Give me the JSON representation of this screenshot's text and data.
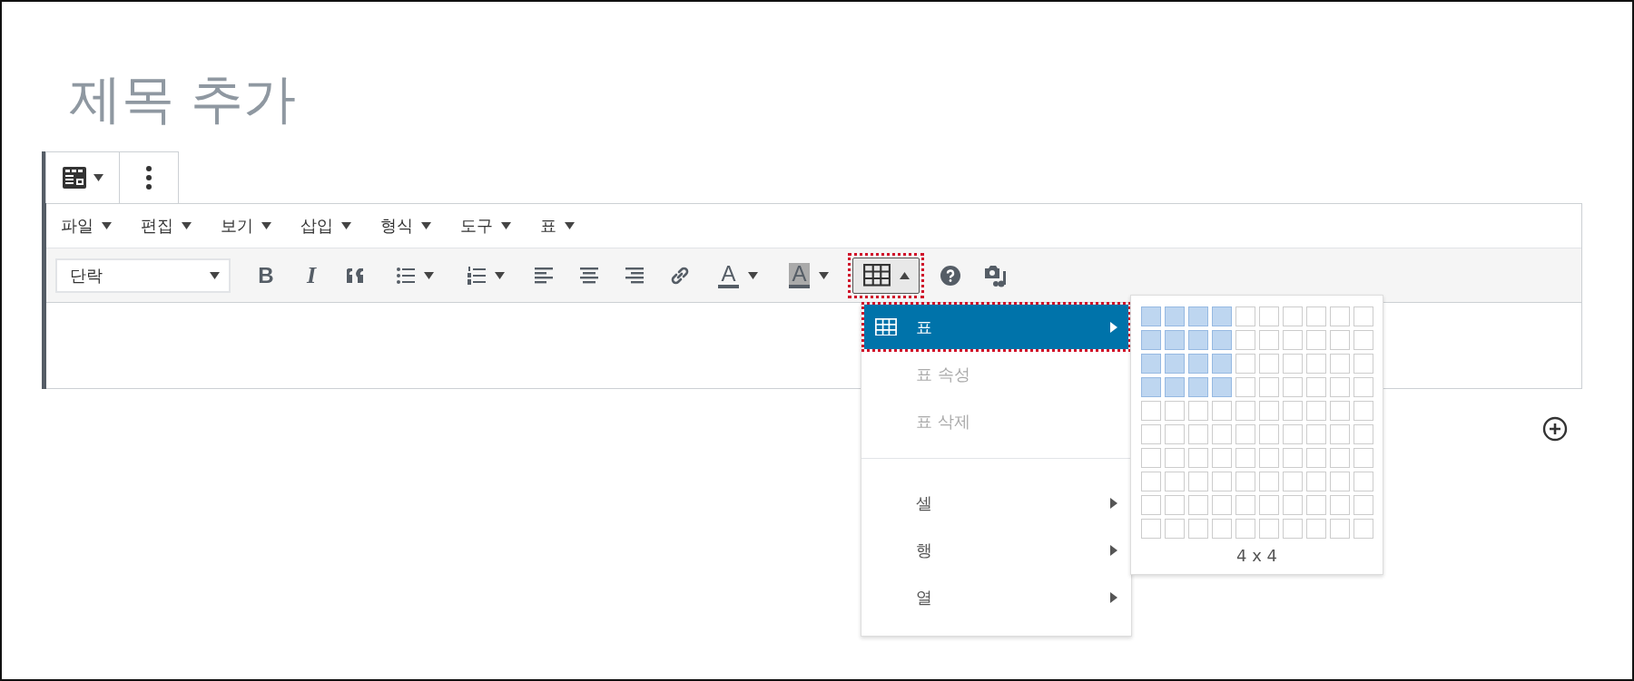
{
  "title_placeholder": "제목 추가",
  "block_toolbar": [
    {
      "kind": "block-type",
      "dropdown": true
    },
    {
      "kind": "more"
    }
  ],
  "menubar": [
    {
      "label": "파일"
    },
    {
      "label": "편집"
    },
    {
      "label": "보기"
    },
    {
      "label": "삽입"
    },
    {
      "label": "형식"
    },
    {
      "label": "도구"
    },
    {
      "label": "표"
    }
  ],
  "toolbar": [
    {
      "kind": "format-select",
      "value": "단락"
    },
    {
      "kind": "bold",
      "label": "B",
      "dropdown": false
    },
    {
      "kind": "italic",
      "label": "I",
      "dropdown": false
    },
    {
      "kind": "quote",
      "dropdown": false
    },
    {
      "kind": "bullet-list",
      "dropdown": true
    },
    {
      "kind": "number-list",
      "dropdown": true
    },
    {
      "kind": "align-left",
      "dropdown": false
    },
    {
      "kind": "align-center",
      "dropdown": false
    },
    {
      "kind": "align-right",
      "dropdown": false
    },
    {
      "kind": "link",
      "dropdown": false
    },
    {
      "kind": "text-color",
      "label": "A",
      "dropdown": true
    },
    {
      "kind": "background-color",
      "label": "A",
      "dropdown": true
    },
    {
      "kind": "table",
      "dropdown": true,
      "pressed": true,
      "highlighted": true
    },
    {
      "kind": "help",
      "dropdown": false
    },
    {
      "kind": "media",
      "dropdown": false
    }
  ],
  "table_menu": [
    {
      "kind": "icon-item",
      "label": "표",
      "selected": true,
      "disabled": false,
      "submenu": true,
      "highlighted": true
    },
    {
      "kind": "item",
      "label": "표 속성",
      "selected": false,
      "disabled": true,
      "submenu": false,
      "highlighted": false
    },
    {
      "kind": "item",
      "label": "표 삭제",
      "selected": false,
      "disabled": true,
      "submenu": false,
      "highlighted": false
    },
    {
      "kind": "separator"
    },
    {
      "kind": "item",
      "label": "셀",
      "selected": false,
      "disabled": false,
      "submenu": true,
      "highlighted": false
    },
    {
      "kind": "item",
      "label": "행",
      "selected": false,
      "disabled": false,
      "submenu": true,
      "highlighted": false
    },
    {
      "kind": "item",
      "label": "열",
      "selected": false,
      "disabled": false,
      "submenu": true,
      "highlighted": false
    }
  ],
  "table_grid": {
    "cells": [
      [
        true,
        true,
        true,
        true,
        false,
        false,
        false,
        false,
        false,
        false
      ],
      [
        true,
        true,
        true,
        true,
        false,
        false,
        false,
        false,
        false,
        false
      ],
      [
        true,
        true,
        true,
        true,
        false,
        false,
        false,
        false,
        false,
        false
      ],
      [
        true,
        true,
        true,
        true,
        false,
        false,
        false,
        false,
        false,
        false
      ],
      [
        false,
        false,
        false,
        false,
        false,
        false,
        false,
        false,
        false,
        false
      ],
      [
        false,
        false,
        false,
        false,
        false,
        false,
        false,
        false,
        false,
        false
      ],
      [
        false,
        false,
        false,
        false,
        false,
        false,
        false,
        false,
        false,
        false
      ],
      [
        false,
        false,
        false,
        false,
        false,
        false,
        false,
        false,
        false,
        false
      ],
      [
        false,
        false,
        false,
        false,
        false,
        false,
        false,
        false,
        false,
        false
      ],
      [
        false,
        false,
        false,
        false,
        false,
        false,
        false,
        false,
        false,
        false
      ]
    ],
    "size_label": "4 x 4"
  }
}
